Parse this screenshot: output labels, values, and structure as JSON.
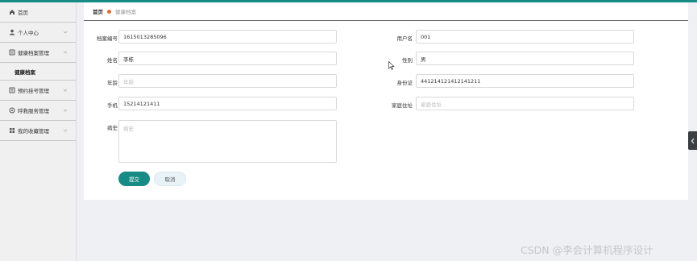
{
  "sidebar": {
    "items": [
      {
        "label": "首页",
        "icon": "home-icon"
      },
      {
        "label": "个人中心",
        "icon": "user-icon"
      },
      {
        "label": "健康档案管理",
        "icon": "archive-icon"
      },
      {
        "label": "预约挂号管理",
        "icon": "appointment-icon"
      },
      {
        "label": "呼救服务管理",
        "icon": "rescue-icon"
      },
      {
        "label": "我的收藏管理",
        "icon": "grid-icon"
      }
    ],
    "sub_item": "健康档案"
  },
  "breadcrumb": {
    "home": "首页",
    "current": "健康档案"
  },
  "form": {
    "archive_no": {
      "label": "档案编号",
      "value": "1615013285096"
    },
    "username": {
      "label": "用户名",
      "value": "001"
    },
    "name": {
      "label": "姓名",
      "value": "李栋"
    },
    "gender": {
      "label": "性别",
      "value": "男"
    },
    "age": {
      "label": "年龄",
      "placeholder": "年龄"
    },
    "id_card": {
      "label": "身份证",
      "value": "441214121412141211"
    },
    "phone": {
      "label": "手机",
      "value": "15214121411"
    },
    "address": {
      "label": "家庭住址",
      "placeholder": "家庭住址"
    },
    "history": {
      "label": "病史",
      "placeholder": "病史"
    }
  },
  "buttons": {
    "submit": "提交",
    "cancel": "取消"
  },
  "watermark": "CSDN @李会计算机程序设计",
  "colors": {
    "accent": "#178b85",
    "breadcrumb_dot": "#e86a2a"
  }
}
